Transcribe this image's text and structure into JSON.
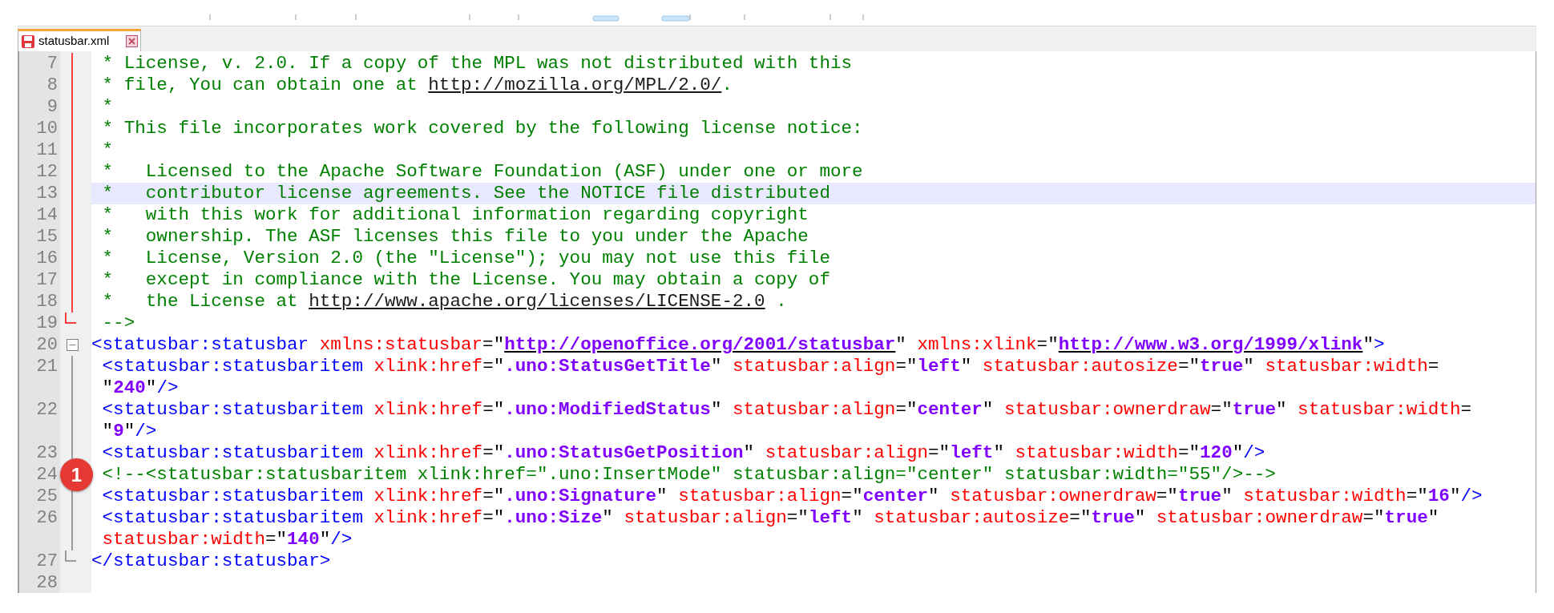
{
  "tab": {
    "label": "statusbar.xml",
    "modified": true
  },
  "lines": [
    {
      "number": "7",
      "fold": {
        "kind": "inside",
        "active": true
      },
      "current": false,
      "segments": [
        {
          "kind": "comment",
          "text": " * License, v. 2.0. If a copy of the MPL was not distributed with this"
        }
      ]
    },
    {
      "number": "8",
      "fold": {
        "kind": "inside",
        "active": true
      },
      "current": false,
      "segments": [
        {
          "kind": "comment",
          "text": " * file, You can obtain one at "
        },
        {
          "kind": "comment_link",
          "text": "http://mozilla.org/MPL/2.0/"
        },
        {
          "kind": "comment",
          "text": "."
        }
      ]
    },
    {
      "number": "9",
      "fold": {
        "kind": "inside",
        "active": true
      },
      "current": false,
      "segments": [
        {
          "kind": "comment",
          "text": " *"
        }
      ]
    },
    {
      "number": "10",
      "fold": {
        "kind": "inside",
        "active": true
      },
      "current": false,
      "segments": [
        {
          "kind": "comment",
          "text": " * This file incorporates work covered by the following license notice:"
        }
      ]
    },
    {
      "number": "11",
      "fold": {
        "kind": "inside",
        "active": true
      },
      "current": false,
      "segments": [
        {
          "kind": "comment",
          "text": " *"
        }
      ]
    },
    {
      "number": "12",
      "fold": {
        "kind": "inside",
        "active": true
      },
      "current": false,
      "segments": [
        {
          "kind": "comment",
          "text": " *   Licensed to the Apache Software Foundation (ASF) under one or more"
        }
      ]
    },
    {
      "number": "13",
      "fold": {
        "kind": "inside",
        "active": true
      },
      "current": true,
      "segments": [
        {
          "kind": "comment",
          "text": " *   contributor license agreements. See the NOTICE file distributed"
        }
      ]
    },
    {
      "number": "14",
      "fold": {
        "kind": "inside",
        "active": true
      },
      "current": false,
      "segments": [
        {
          "kind": "comment",
          "text": " *   with this work for additional information regarding copyright"
        }
      ]
    },
    {
      "number": "15",
      "fold": {
        "kind": "inside",
        "active": true
      },
      "current": false,
      "segments": [
        {
          "kind": "comment",
          "text": " *   ownership. The ASF licenses this file to you under the Apache"
        }
      ]
    },
    {
      "number": "16",
      "fold": {
        "kind": "inside",
        "active": true
      },
      "current": false,
      "segments": [
        {
          "kind": "comment",
          "text": " *   License, Version 2.0 (the \"License\"); you may not use this file"
        }
      ]
    },
    {
      "number": "17",
      "fold": {
        "kind": "inside",
        "active": true
      },
      "current": false,
      "segments": [
        {
          "kind": "comment",
          "text": " *   except in compliance with the License. You may obtain a copy of"
        }
      ]
    },
    {
      "number": "18",
      "fold": {
        "kind": "inside",
        "active": true
      },
      "current": false,
      "segments": [
        {
          "kind": "comment",
          "text": " *   the License at "
        },
        {
          "kind": "comment_link",
          "text": "http://www.apache.org/licenses/LICENSE-2.0"
        },
        {
          "kind": "comment",
          "text": " ."
        }
      ]
    },
    {
      "number": "19",
      "fold": {
        "kind": "end",
        "active": true
      },
      "current": false,
      "segments": [
        {
          "kind": "comment",
          "text": " -->"
        }
      ]
    },
    {
      "number": "20",
      "fold": {
        "kind": "start",
        "active": false
      },
      "current": false,
      "segments": [
        {
          "kind": "tag",
          "text": "<statusbar:statusbar"
        },
        {
          "kind": "attr",
          "text": " xmlns:statusbar"
        },
        {
          "kind": "punct",
          "text": "=\""
        },
        {
          "kind": "value_link",
          "text": "http://openoffice.org/2001/statusbar"
        },
        {
          "kind": "punct",
          "text": "\""
        },
        {
          "kind": "attr",
          "text": " xmlns:xlink"
        },
        {
          "kind": "punct",
          "text": "=\""
        },
        {
          "kind": "value_link",
          "text": "http://www.w3.org/1999/xlink"
        },
        {
          "kind": "punct",
          "text": "\""
        },
        {
          "kind": "tag",
          "text": ">"
        }
      ]
    },
    {
      "number": "21",
      "fold": {
        "kind": "inside",
        "active": false
      },
      "current": false,
      "segments": [
        {
          "kind": "tag",
          "text": " <statusbar:statusbaritem"
        },
        {
          "kind": "attr",
          "text": " xlink:href"
        },
        {
          "kind": "punct",
          "text": "=\""
        },
        {
          "kind": "value",
          "text": ".uno:StatusGetTitle"
        },
        {
          "kind": "punct",
          "text": "\""
        },
        {
          "kind": "attr",
          "text": " statusbar:align"
        },
        {
          "kind": "punct",
          "text": "=\""
        },
        {
          "kind": "value",
          "text": "left"
        },
        {
          "kind": "punct",
          "text": "\""
        },
        {
          "kind": "attr",
          "text": " statusbar:autosize"
        },
        {
          "kind": "punct",
          "text": "=\""
        },
        {
          "kind": "value",
          "text": "true"
        },
        {
          "kind": "punct",
          "text": "\""
        },
        {
          "kind": "attr",
          "text": " statusbar:width"
        },
        {
          "kind": "punct",
          "text": "="
        }
      ],
      "wrapped": [
        {
          "kind": "punct",
          "text": " \""
        },
        {
          "kind": "value",
          "text": "240"
        },
        {
          "kind": "punct",
          "text": "\""
        },
        {
          "kind": "tag",
          "text": "/>"
        }
      ]
    },
    {
      "number": "22",
      "fold": {
        "kind": "inside",
        "active": false
      },
      "current": false,
      "segments": [
        {
          "kind": "tag",
          "text": " <statusbar:statusbaritem"
        },
        {
          "kind": "attr",
          "text": " xlink:href"
        },
        {
          "kind": "punct",
          "text": "=\""
        },
        {
          "kind": "value",
          "text": ".uno:ModifiedStatus"
        },
        {
          "kind": "punct",
          "text": "\""
        },
        {
          "kind": "attr",
          "text": " statusbar:align"
        },
        {
          "kind": "punct",
          "text": "=\""
        },
        {
          "kind": "value",
          "text": "center"
        },
        {
          "kind": "punct",
          "text": "\""
        },
        {
          "kind": "attr",
          "text": " statusbar:ownerdraw"
        },
        {
          "kind": "punct",
          "text": "=\""
        },
        {
          "kind": "value",
          "text": "true"
        },
        {
          "kind": "punct",
          "text": "\""
        },
        {
          "kind": "attr",
          "text": " statusbar:width"
        },
        {
          "kind": "punct",
          "text": "="
        }
      ],
      "wrapped": [
        {
          "kind": "punct",
          "text": " \""
        },
        {
          "kind": "value",
          "text": "9"
        },
        {
          "kind": "punct",
          "text": "\""
        },
        {
          "kind": "tag",
          "text": "/>"
        }
      ]
    },
    {
      "number": "23",
      "fold": {
        "kind": "inside",
        "active": false
      },
      "current": false,
      "segments": [
        {
          "kind": "tag",
          "text": " <statusbar:statusbaritem"
        },
        {
          "kind": "attr",
          "text": " xlink:href"
        },
        {
          "kind": "punct",
          "text": "=\""
        },
        {
          "kind": "value",
          "text": ".uno:StatusGetPosition"
        },
        {
          "kind": "punct",
          "text": "\""
        },
        {
          "kind": "attr",
          "text": " statusbar:align"
        },
        {
          "kind": "punct",
          "text": "=\""
        },
        {
          "kind": "value",
          "text": "left"
        },
        {
          "kind": "punct",
          "text": "\""
        },
        {
          "kind": "attr",
          "text": " statusbar:width"
        },
        {
          "kind": "punct",
          "text": "=\""
        },
        {
          "kind": "value",
          "text": "120"
        },
        {
          "kind": "punct",
          "text": "\""
        },
        {
          "kind": "tag",
          "text": "/>"
        }
      ]
    },
    {
      "number": "24",
      "current": false,
      "badge": "1",
      "segments": [
        {
          "kind": "comment",
          "text": " <!--<statusbar:statusbaritem xlink:href=\".uno:InsertMode\" statusbar:align=\"center\" statusbar:width=\"55\"/>-->"
        }
      ]
    },
    {
      "number": "25",
      "fold": {
        "kind": "inside",
        "active": false
      },
      "current": false,
      "segments": [
        {
          "kind": "tag",
          "text": " <statusbar:statusbaritem"
        },
        {
          "kind": "attr",
          "text": " xlink:href"
        },
        {
          "kind": "punct",
          "text": "=\""
        },
        {
          "kind": "value",
          "text": ".uno:Signature"
        },
        {
          "kind": "punct",
          "text": "\""
        },
        {
          "kind": "attr",
          "text": " statusbar:align"
        },
        {
          "kind": "punct",
          "text": "=\""
        },
        {
          "kind": "value",
          "text": "center"
        },
        {
          "kind": "punct",
          "text": "\""
        },
        {
          "kind": "attr",
          "text": " statusbar:ownerdraw"
        },
        {
          "kind": "punct",
          "text": "=\""
        },
        {
          "kind": "value",
          "text": "true"
        },
        {
          "kind": "punct",
          "text": "\""
        },
        {
          "kind": "attr",
          "text": " statusbar:width"
        },
        {
          "kind": "punct",
          "text": "=\""
        },
        {
          "kind": "value",
          "text": "16"
        },
        {
          "kind": "punct",
          "text": "\""
        },
        {
          "kind": "tag",
          "text": "/>"
        }
      ]
    },
    {
      "number": "26",
      "fold": {
        "kind": "inside",
        "active": false
      },
      "current": false,
      "segments": [
        {
          "kind": "tag",
          "text": " <statusbar:statusbaritem"
        },
        {
          "kind": "attr",
          "text": " xlink:href"
        },
        {
          "kind": "punct",
          "text": "=\""
        },
        {
          "kind": "value",
          "text": ".uno:Size"
        },
        {
          "kind": "punct",
          "text": "\""
        },
        {
          "kind": "attr",
          "text": " statusbar:align"
        },
        {
          "kind": "punct",
          "text": "=\""
        },
        {
          "kind": "value",
          "text": "left"
        },
        {
          "kind": "punct",
          "text": "\""
        },
        {
          "kind": "attr",
          "text": " statusbar:autosize"
        },
        {
          "kind": "punct",
          "text": "=\""
        },
        {
          "kind": "value",
          "text": "true"
        },
        {
          "kind": "punct",
          "text": "\""
        },
        {
          "kind": "attr",
          "text": " statusbar:ownerdraw"
        },
        {
          "kind": "punct",
          "text": "=\""
        },
        {
          "kind": "value",
          "text": "true"
        },
        {
          "kind": "punct",
          "text": "\""
        }
      ],
      "wrapped": [
        {
          "kind": "attr",
          "text": " statusbar:width"
        },
        {
          "kind": "punct",
          "text": "=\""
        },
        {
          "kind": "value",
          "text": "140"
        },
        {
          "kind": "punct",
          "text": "\""
        },
        {
          "kind": "tag",
          "text": "/>"
        }
      ]
    },
    {
      "number": "27",
      "fold": {
        "kind": "end",
        "active": false
      },
      "current": false,
      "segments": [
        {
          "kind": "tag",
          "text": "</statusbar:statusbar>"
        }
      ]
    },
    {
      "number": "28",
      "current": false
    }
  ]
}
